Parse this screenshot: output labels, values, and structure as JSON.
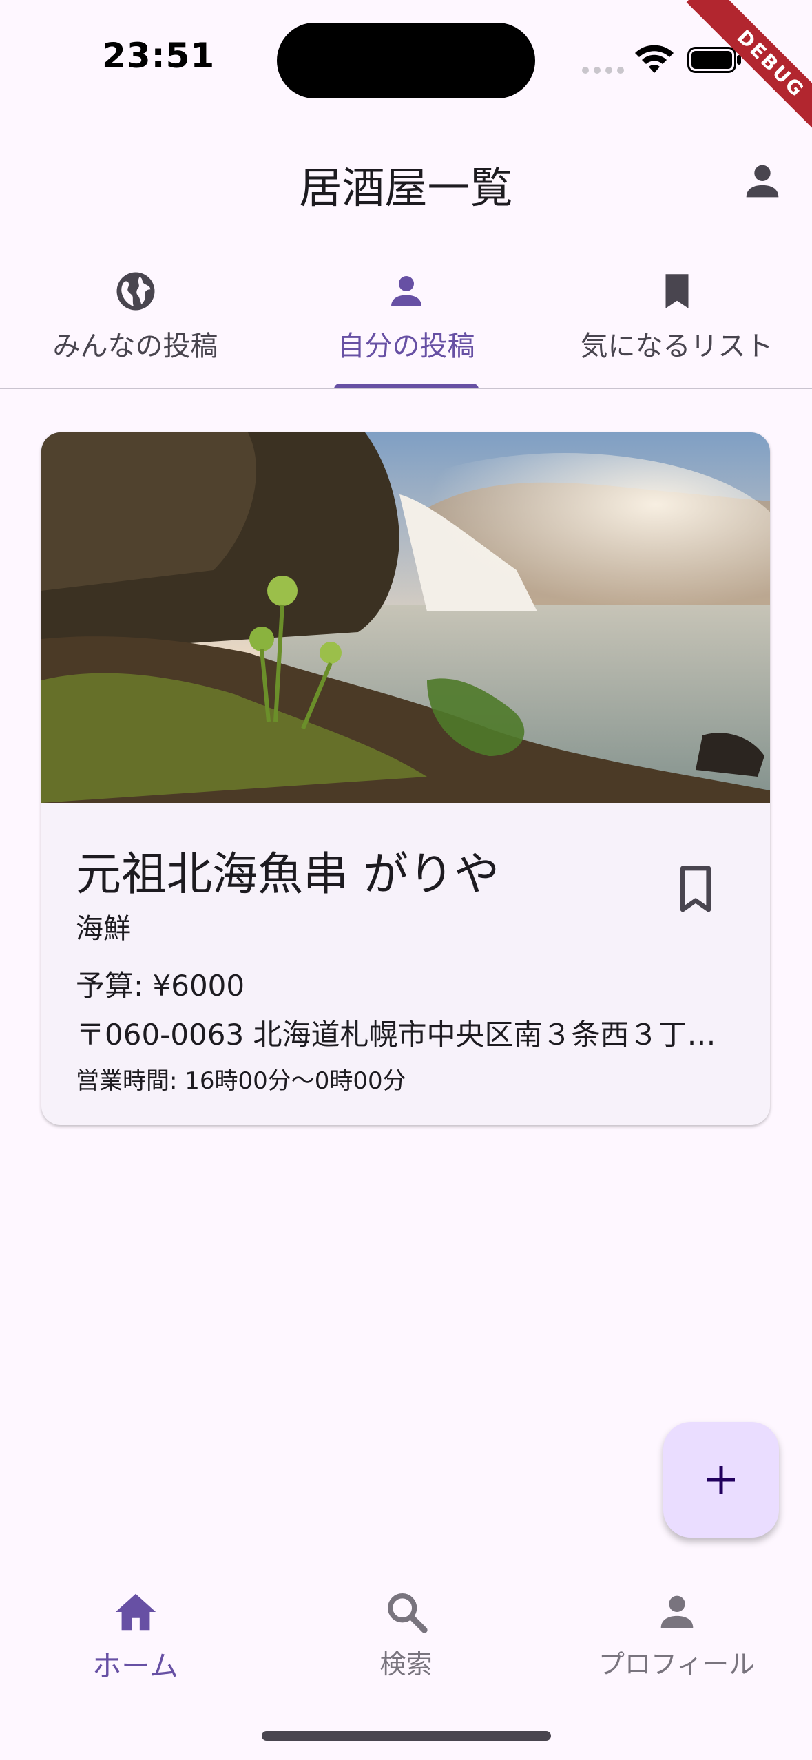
{
  "status_bar": {
    "time": "23:51",
    "wifi_icon": "wifi-icon",
    "battery_icon": "battery-icon"
  },
  "debug_banner": "DEBUG",
  "app_bar": {
    "title": "居酒屋一覧",
    "profile_icon": "person-icon"
  },
  "tabs": [
    {
      "label": "みんなの投稿",
      "icon": "globe-icon",
      "active": false
    },
    {
      "label": "自分の投稿",
      "icon": "person-icon",
      "active": true
    },
    {
      "label": "気になるリスト",
      "icon": "bookmark-icon",
      "active": false
    }
  ],
  "card": {
    "image_icon": "waterfall-photo",
    "name": "元祖北海魚串 がりや",
    "genre": "海鮮",
    "budget": "予算: ¥6000",
    "address": "〒060-0063 北海道札幌市中央区南３条西３丁…",
    "hours": "営業時間:  16時00分〜0時00分",
    "bookmark_icon": "bookmark-outline-icon"
  },
  "fab": {
    "icon": "plus-icon"
  },
  "bottom_nav": [
    {
      "label": "ホーム",
      "icon": "home-icon",
      "active": true
    },
    {
      "label": "検索",
      "icon": "search-icon",
      "active": false
    },
    {
      "label": "プロフィール",
      "icon": "person-icon",
      "active": false
    }
  ],
  "colors": {
    "primary": "#6750a4",
    "background": "#fef7ff",
    "card": "#f7f2fa",
    "fab": "#eaddff"
  }
}
